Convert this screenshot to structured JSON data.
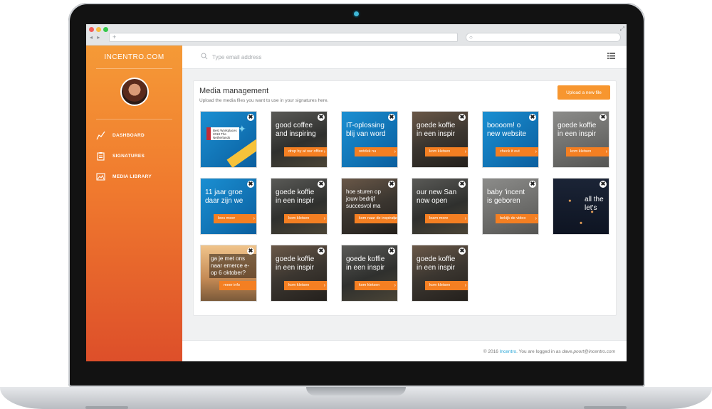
{
  "sidebar": {
    "brand": "INCENTRO.COM",
    "items": [
      {
        "label": "DASHBOARD",
        "icon": "chart-line-icon"
      },
      {
        "label": "SIGNATURES",
        "icon": "clipboard-icon"
      },
      {
        "label": "MEDIA LIBRARY",
        "icon": "image-icon"
      }
    ]
  },
  "topbar": {
    "search_placeholder": "Type email address"
  },
  "media": {
    "title": "Media management",
    "subtitle": "Upload the media files you want to use in your signatures here.",
    "upload_label": "Upload a new file",
    "close_glyph": "✖",
    "tiles": [
      {
        "headline": "",
        "cta": "",
        "award": "Best Workplaces 2018 The Netherlands"
      },
      {
        "headline": "good coffee\nand inspiring",
        "cta": "drop by at our office"
      },
      {
        "headline": "IT-oplossing\nblij van word",
        "cta": "ontdek nu"
      },
      {
        "headline": "goede koffie\nin een inspir",
        "cta": "kom kletsen"
      },
      {
        "headline": "boooom! o\nnew website",
        "cta": "check it out"
      },
      {
        "headline": "goede koffie\nin een inspir",
        "cta": "kom kletsen"
      },
      {
        "headline": "11 jaar groe\ndaar zijn we",
        "cta": "lees meer"
      },
      {
        "headline": "goede koffie\nin een inspir",
        "cta": "kom kletsen"
      },
      {
        "headline": "hoe sturen op\njouw bedrijf\nsuccesvol ma",
        "cta": "kom naar de inspiratie"
      },
      {
        "headline": "our new San\nnow open",
        "cta": "learn more"
      },
      {
        "headline": "baby 'incent\nis geboren",
        "cta": "bekijk de video"
      },
      {
        "headline": "all the\nlet's",
        "cta": ""
      },
      {
        "headline": "ga je met ons\nnaar emerce e-\nop 6 oktober?",
        "cta": "meer info"
      },
      {
        "headline": "goede koffie\nin een inspir",
        "cta": "kom kletsen"
      },
      {
        "headline": "goede koffie\nin een inspir",
        "cta": "kom kletsen"
      },
      {
        "headline": "goede koffie\nin een inspir",
        "cta": "kom kletsen"
      }
    ]
  },
  "footer": {
    "prefix": "© 2016 ",
    "brand": "Incentro",
    "middle": ". You are logged in as ",
    "email": "dave.poort@incentro.com"
  },
  "colors": {
    "accent": "#f7962f",
    "sidebar_top": "#f59a37",
    "sidebar_bottom": "#dd4f2a",
    "link": "#2aa7d8"
  }
}
